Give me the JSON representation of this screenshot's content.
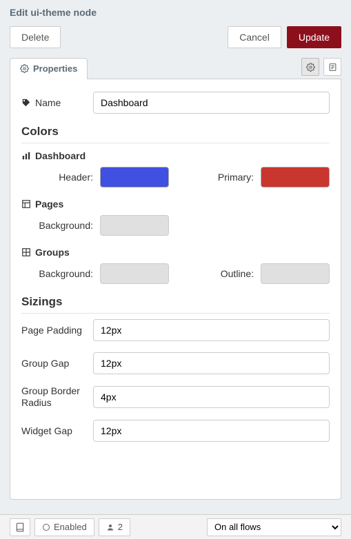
{
  "header": {
    "title": "Edit ui-theme node"
  },
  "buttons": {
    "delete": "Delete",
    "cancel": "Cancel",
    "update": "Update"
  },
  "tabs": {
    "properties": "Properties"
  },
  "form": {
    "name_label": "Name",
    "name_value": "Dashboard"
  },
  "sections": {
    "colors": "Colors",
    "dashboard": "Dashboard",
    "pages": "Pages",
    "groups": "Groups",
    "sizings": "Sizings"
  },
  "colors": {
    "header_label": "Header:",
    "header_value": "#4050e0",
    "primary_label": "Primary:",
    "primary_value": "#c9362e",
    "pages_bg_label": "Background:",
    "pages_bg_value": "#e0e0e0",
    "groups_bg_label": "Background:",
    "groups_bg_value": "#e0e0e0",
    "groups_outline_label": "Outline:",
    "groups_outline_value": "#e0e0e0"
  },
  "sizings": {
    "page_padding_label": "Page Padding",
    "page_padding_value": "12px",
    "group_gap_label": "Group Gap",
    "group_gap_value": "12px",
    "group_border_radius_label": "Group Border Radius",
    "group_border_radius_value": "4px",
    "widget_gap_label": "Widget Gap",
    "widget_gap_value": "12px"
  },
  "footer": {
    "enabled": "Enabled",
    "users": "2",
    "scope": "On all flows"
  }
}
